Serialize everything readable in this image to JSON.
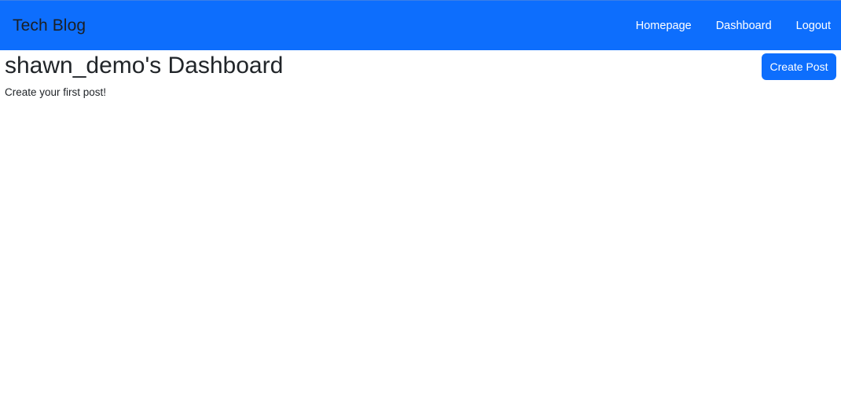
{
  "navbar": {
    "brand": "Tech Blog",
    "links": [
      {
        "label": "Homepage"
      },
      {
        "label": "Dashboard"
      },
      {
        "label": "Logout"
      }
    ],
    "background_color": "#0d6efd"
  },
  "dashboard": {
    "title": "shawn_demo's Dashboard",
    "create_button_label": "Create Post",
    "empty_message": "Create your first post!"
  }
}
